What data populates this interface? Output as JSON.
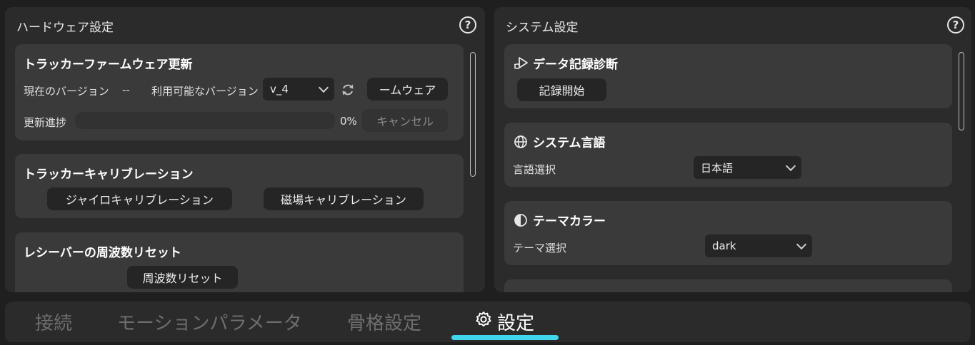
{
  "hardware": {
    "title": "ハードウェア設定",
    "help_icon": "?",
    "firmware": {
      "title": "トラッカーファームウェア更新",
      "current_label": "現在のバージョン",
      "current_value": "--",
      "available_label": "利用可能なバージョン",
      "version_selected": "v_4",
      "update_button": "ームウェア",
      "progress_label": "更新進捗",
      "progress_percent": 0,
      "progress_text": "0%",
      "cancel_button": "キャンセル"
    },
    "calibration": {
      "title": "トラッカーキャリブレーション",
      "gyro_button": "ジャイロキャリブレーション",
      "mag_button": "磁場キャリブレーション"
    },
    "receiver": {
      "title": "レシーバーの周波数リセット",
      "reset_button": "周波数リセット"
    }
  },
  "system": {
    "title": "システム設定",
    "help_icon": "?",
    "diagnostics": {
      "title": "データ記録診断",
      "start_button": "記録開始"
    },
    "language": {
      "title": "システム言語",
      "label": "言語選択",
      "selected": "日本語"
    },
    "theme": {
      "title": "テーマカラー",
      "label": "テーマ選択",
      "selected": "dark"
    }
  },
  "tabs": [
    {
      "label": "接続",
      "active": false
    },
    {
      "label": "モーションパラメータ",
      "active": false
    },
    {
      "label": "骨格設定",
      "active": false
    },
    {
      "label": "設定",
      "active": true
    }
  ],
  "colors": {
    "accent": "#40d6ec",
    "panel": "#2b2b2b",
    "card": "#3a3a3a",
    "button": "#252525"
  },
  "icons": {
    "help": "help-circle-icon",
    "refresh": "refresh-icon",
    "diagnostics": "debug-play-icon",
    "language": "globe-icon",
    "theme": "half-circle-icon",
    "settings_tab": "gear-icon"
  }
}
